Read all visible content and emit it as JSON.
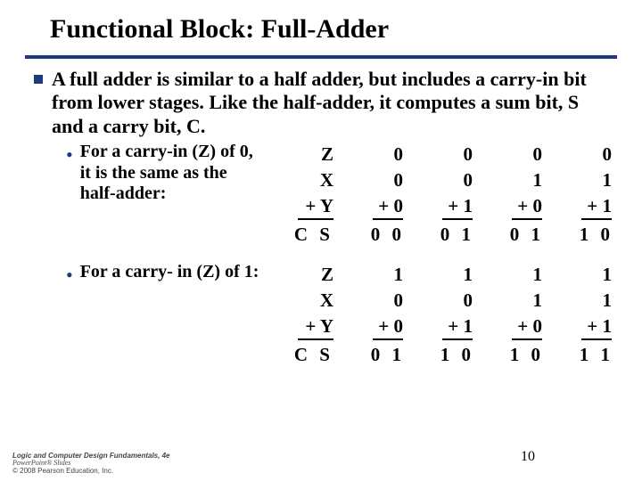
{
  "title": "Functional Block: Full-Adder",
  "para": "A full adder is similar to a half adder, but includes a carry-in bit from lower stages.   Like the half-adder, it computes a sum bit, S and a carry bit, C.",
  "sub1": "For a carry-in (Z) of 0, it is the same as the half-adder:",
  "sub2": "For a carry- in (Z) of 1:",
  "labels": {
    "z": "Z",
    "x": "X",
    "plusY": "Y",
    "cs": "C S"
  },
  "t1": {
    "z": [
      "0",
      "0",
      "0",
      "0"
    ],
    "x": [
      "0",
      "0",
      "1",
      "1"
    ],
    "y": [
      "0",
      "1",
      "0",
      "1"
    ],
    "cs": [
      "0 0",
      "0 1",
      "0 1",
      "1 0"
    ]
  },
  "t2": {
    "z": [
      "1",
      "1",
      "1",
      "1"
    ],
    "x": [
      "0",
      "0",
      "1",
      "1"
    ],
    "y": [
      "0",
      "1",
      "0",
      "1"
    ],
    "cs": [
      "0 1",
      "1 0",
      "1 0",
      "1 1"
    ]
  },
  "footer": {
    "l1": "Logic and Computer Design Fundamentals, 4e",
    "l2": "PowerPoint® Slides",
    "l3": "© 2008 Pearson Education, Inc."
  },
  "page": "10"
}
